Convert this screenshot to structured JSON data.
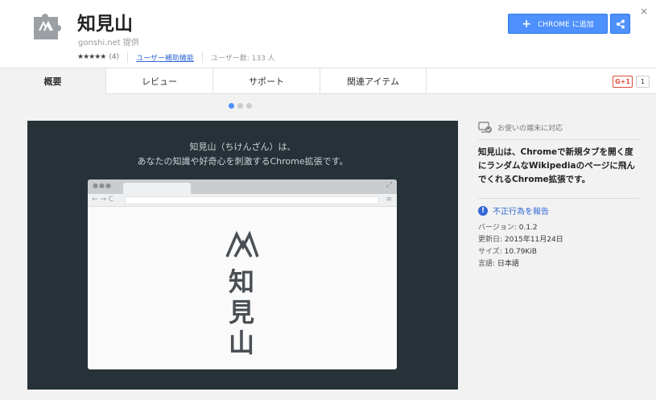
{
  "header": {
    "title": "知見山",
    "provider": "gonshi.net 提供",
    "stars": "★★★★★",
    "rating_count": "(4)",
    "category": "ユーザー補助機能",
    "user_count": "ユーザー数: 133 人",
    "add_button": "CHROME に追加",
    "close": "×"
  },
  "tabs": [
    {
      "label": "概要",
      "active": true
    },
    {
      "label": "レビュー",
      "active": false
    },
    {
      "label": "サポート",
      "active": false
    },
    {
      "label": "関連アイテム",
      "active": false
    }
  ],
  "social": {
    "gplus": "G+1",
    "count": "1"
  },
  "carousel": {
    "total": 3,
    "active_index": 0
  },
  "slide": {
    "line1": "知見山（ちけんざん）は、",
    "line2": "あなたの知識や好奇心を刺激するChrome拡張です。",
    "logo_chars": [
      "知",
      "見",
      "山"
    ]
  },
  "sidebar": {
    "compat": "お使いの端末に対応",
    "description": "知見山は、Chromeで新規タブを開く度にランダムなWikipediaのページに飛んでくれるChrome拡張です。",
    "report": "不正行為を報告",
    "version_label": "バージョン:",
    "version": "0.1.2",
    "updated_label": "更新日:",
    "updated": "2015年11月24日",
    "size_label": "サイズ:",
    "size": "10.79KiB",
    "language_label": "言語:",
    "language": "日本語"
  },
  "colors": {
    "accent": "#4d90fe",
    "slide_bg": "#263238",
    "link": "#3367d6"
  }
}
